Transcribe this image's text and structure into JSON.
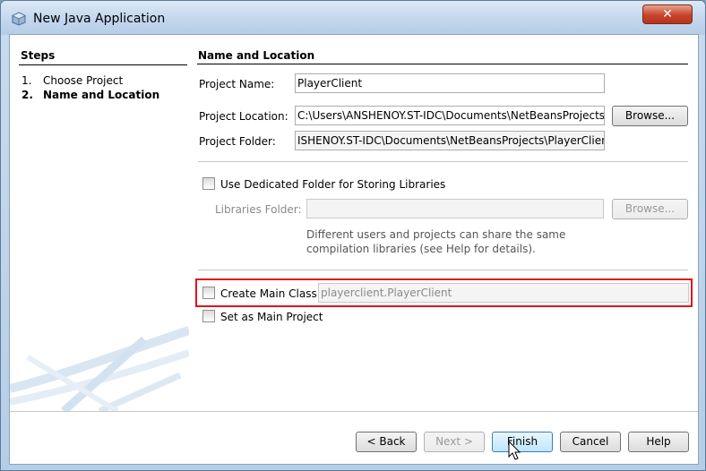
{
  "window": {
    "title": "New Java Application",
    "close_label": "✕"
  },
  "steps": {
    "title": "Steps",
    "items": [
      {
        "num": "1.",
        "label": "Choose Project"
      },
      {
        "num": "2.",
        "label": "Name and Location"
      }
    ]
  },
  "main": {
    "title": "Name and Location",
    "project_name": {
      "label": "Project Name:",
      "value": "PlayerClient"
    },
    "project_location": {
      "label": "Project Location:",
      "value": "C:\\Users\\ANSHENOY.ST-IDC\\Documents\\NetBeansProjects",
      "browse_label": "Browse..."
    },
    "project_folder": {
      "label": "Project Folder:",
      "value": "ISHENOY.ST-IDC\\Documents\\NetBeansProjects\\PlayerClient"
    },
    "dedicated_folder": {
      "label": "Use Dedicated Folder for Storing Libraries"
    },
    "libraries_folder": {
      "label": "Libraries Folder:",
      "value": "",
      "browse_label": "Browse..."
    },
    "libraries_help": [
      "Different users and projects can share the same",
      "compilation libraries (see Help for details)."
    ],
    "create_main_class": {
      "label": "Create Main Class",
      "value": "playerclient.PlayerClient"
    },
    "set_main_project": {
      "label": "Set as Main Project"
    }
  },
  "footer": {
    "back_label": "< Back",
    "next_label": "Next >",
    "finish_label": "Finish",
    "cancel_label": "Cancel",
    "help_label": "Help"
  },
  "colors": {
    "highlight": "#e1131b",
    "titlebar": "#c4d8ee"
  }
}
